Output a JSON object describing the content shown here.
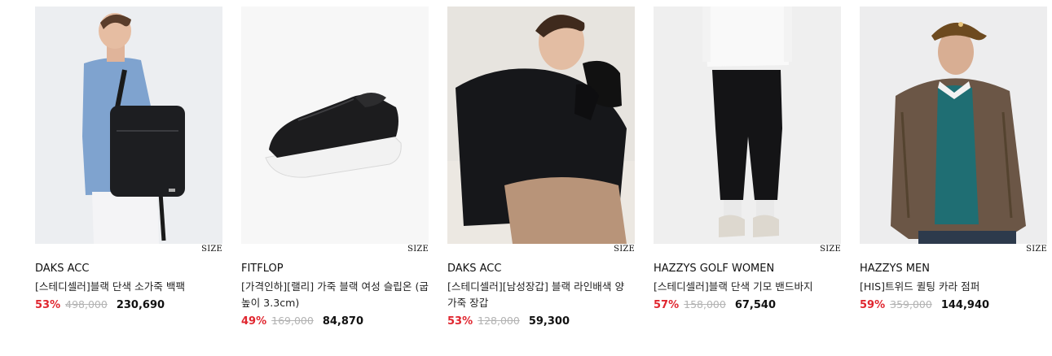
{
  "products": [
    {
      "brand": "DAKS ACC",
      "name": "[스테디셀러]블랙 단색 소가죽 백팩",
      "size_label": "SIZE",
      "discount": "53%",
      "original_price": "498,000",
      "sale_price": "230,690"
    },
    {
      "brand": "FITFLOP",
      "name": "[가격인하][랠리] 가죽 블랙 여성 슬립온 (굽높이 3.3cm)",
      "size_label": "SIZE",
      "discount": "49%",
      "original_price": "169,000",
      "sale_price": "84,870"
    },
    {
      "brand": "DAKS ACC",
      "name": "[스테디셀러][남성장갑] 블랙 라인배색 양 가죽 장갑",
      "size_label": "SIZE",
      "discount": "53%",
      "original_price": "128,000",
      "sale_price": "59,300"
    },
    {
      "brand": "HAZZYS GOLF WOMEN",
      "name": "[스테디셀러]블랙 단색 기모 밴드바지",
      "size_label": "SIZE",
      "discount": "57%",
      "original_price": "158,000",
      "sale_price": "67,540"
    },
    {
      "brand": "HAZZYS MEN",
      "name": "[HIS]트위드 퀼팅 카라 점퍼",
      "size_label": "SIZE",
      "discount": "59%",
      "original_price": "359,000",
      "sale_price": "144,940"
    }
  ],
  "colors": {
    "discount": "#e0262f",
    "strike": "#b3b3b3",
    "thumb_bg": "#f0f0f2"
  }
}
